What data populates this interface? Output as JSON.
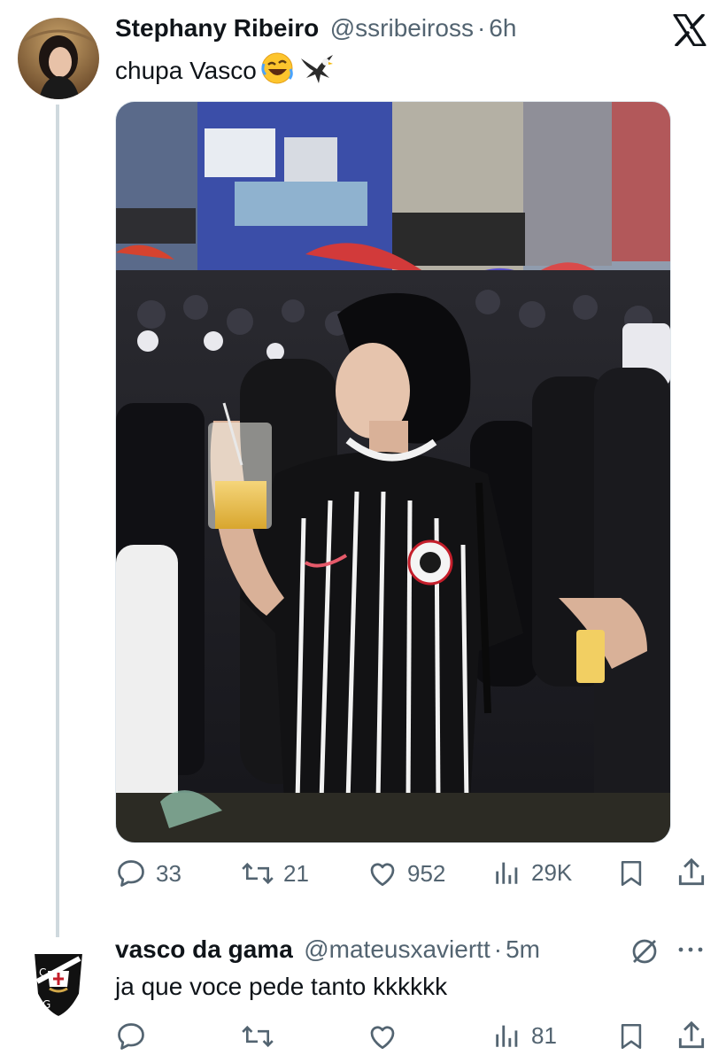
{
  "colors": {
    "text": "#0f1419",
    "muted": "#536471",
    "thread_line": "#cfd9de",
    "jersey_black": "#121214"
  },
  "tweet": {
    "author_name": "Stephany Ribeiro",
    "handle": "@ssribeiross",
    "separator": "·",
    "time": "6h",
    "text": "chupa Vasco",
    "emojis": [
      "rolling-on-floor-laughing-emoji",
      "eagle-emoji"
    ],
    "brand_icon": "x-logo-icon",
    "stats": {
      "replies": "33",
      "retweets": "21",
      "likes": "952",
      "views": "29K"
    }
  },
  "reply": {
    "author_name": "vasco da gama",
    "handle": "@mateusxaviertt",
    "separator": "·",
    "time": "5m",
    "text": "ja que voce pede tanto kkkkkk",
    "stats": {
      "views": "81"
    }
  }
}
